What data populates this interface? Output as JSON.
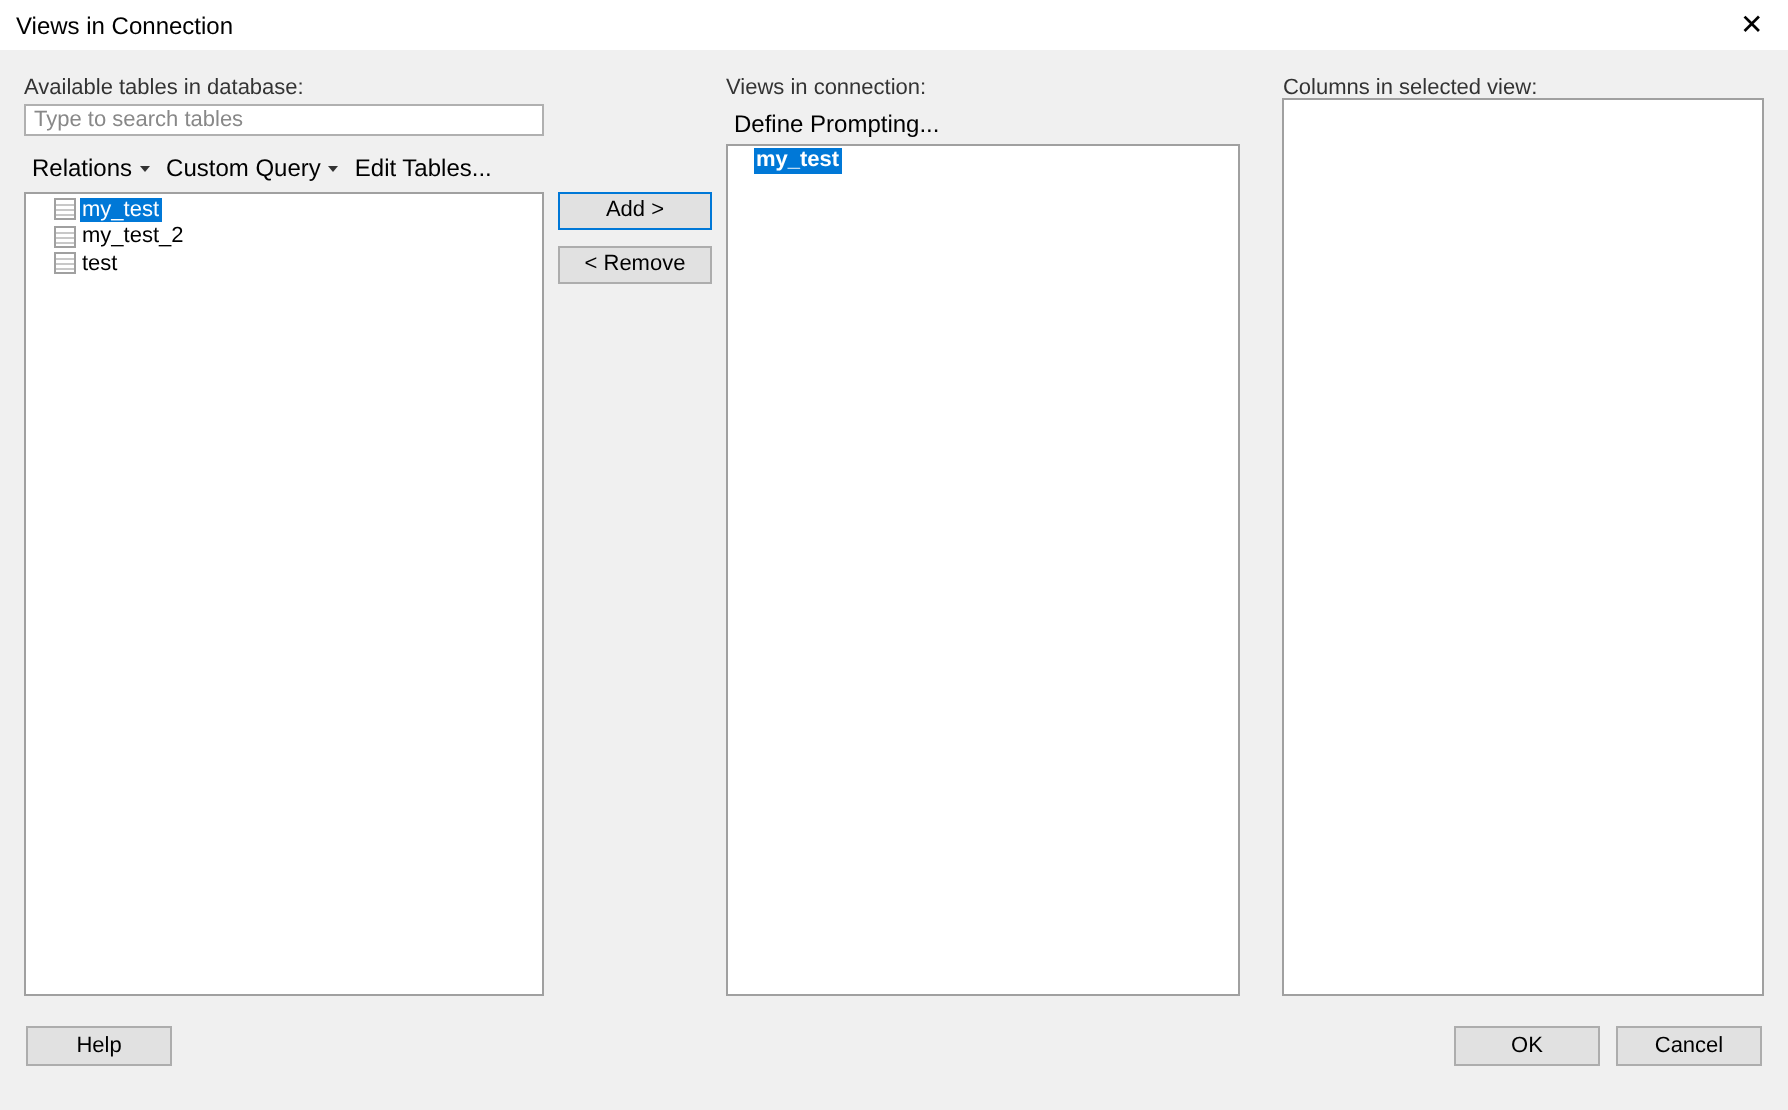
{
  "window": {
    "title": "Views in Connection",
    "close": "✕"
  },
  "available": {
    "label": "Available tables in database:",
    "search": {
      "placeholder": "Type to search tables"
    },
    "menu": [
      {
        "label": "Relations",
        "kind": "dropdown"
      },
      {
        "label": "Custom Query",
        "kind": "dropdown"
      },
      {
        "label": "Edit Tables...",
        "kind": "plain"
      }
    ],
    "tables": [
      {
        "name": "my_test",
        "selected": true
      },
      {
        "name": "my_test_2",
        "selected": false
      },
      {
        "name": "test",
        "selected": false
      }
    ]
  },
  "actions": [
    {
      "label": "Add >",
      "focused": true
    },
    {
      "label": "< Remove",
      "focused": false
    }
  ],
  "views": {
    "label": "Views in connection:",
    "define": "Define Prompting...",
    "items": [
      {
        "name": "my_test",
        "selected": true
      }
    ]
  },
  "columns": {
    "label": "Columns in selected view:"
  },
  "footer": {
    "help": "Help",
    "ok": "OK",
    "cancel": "Cancel"
  }
}
